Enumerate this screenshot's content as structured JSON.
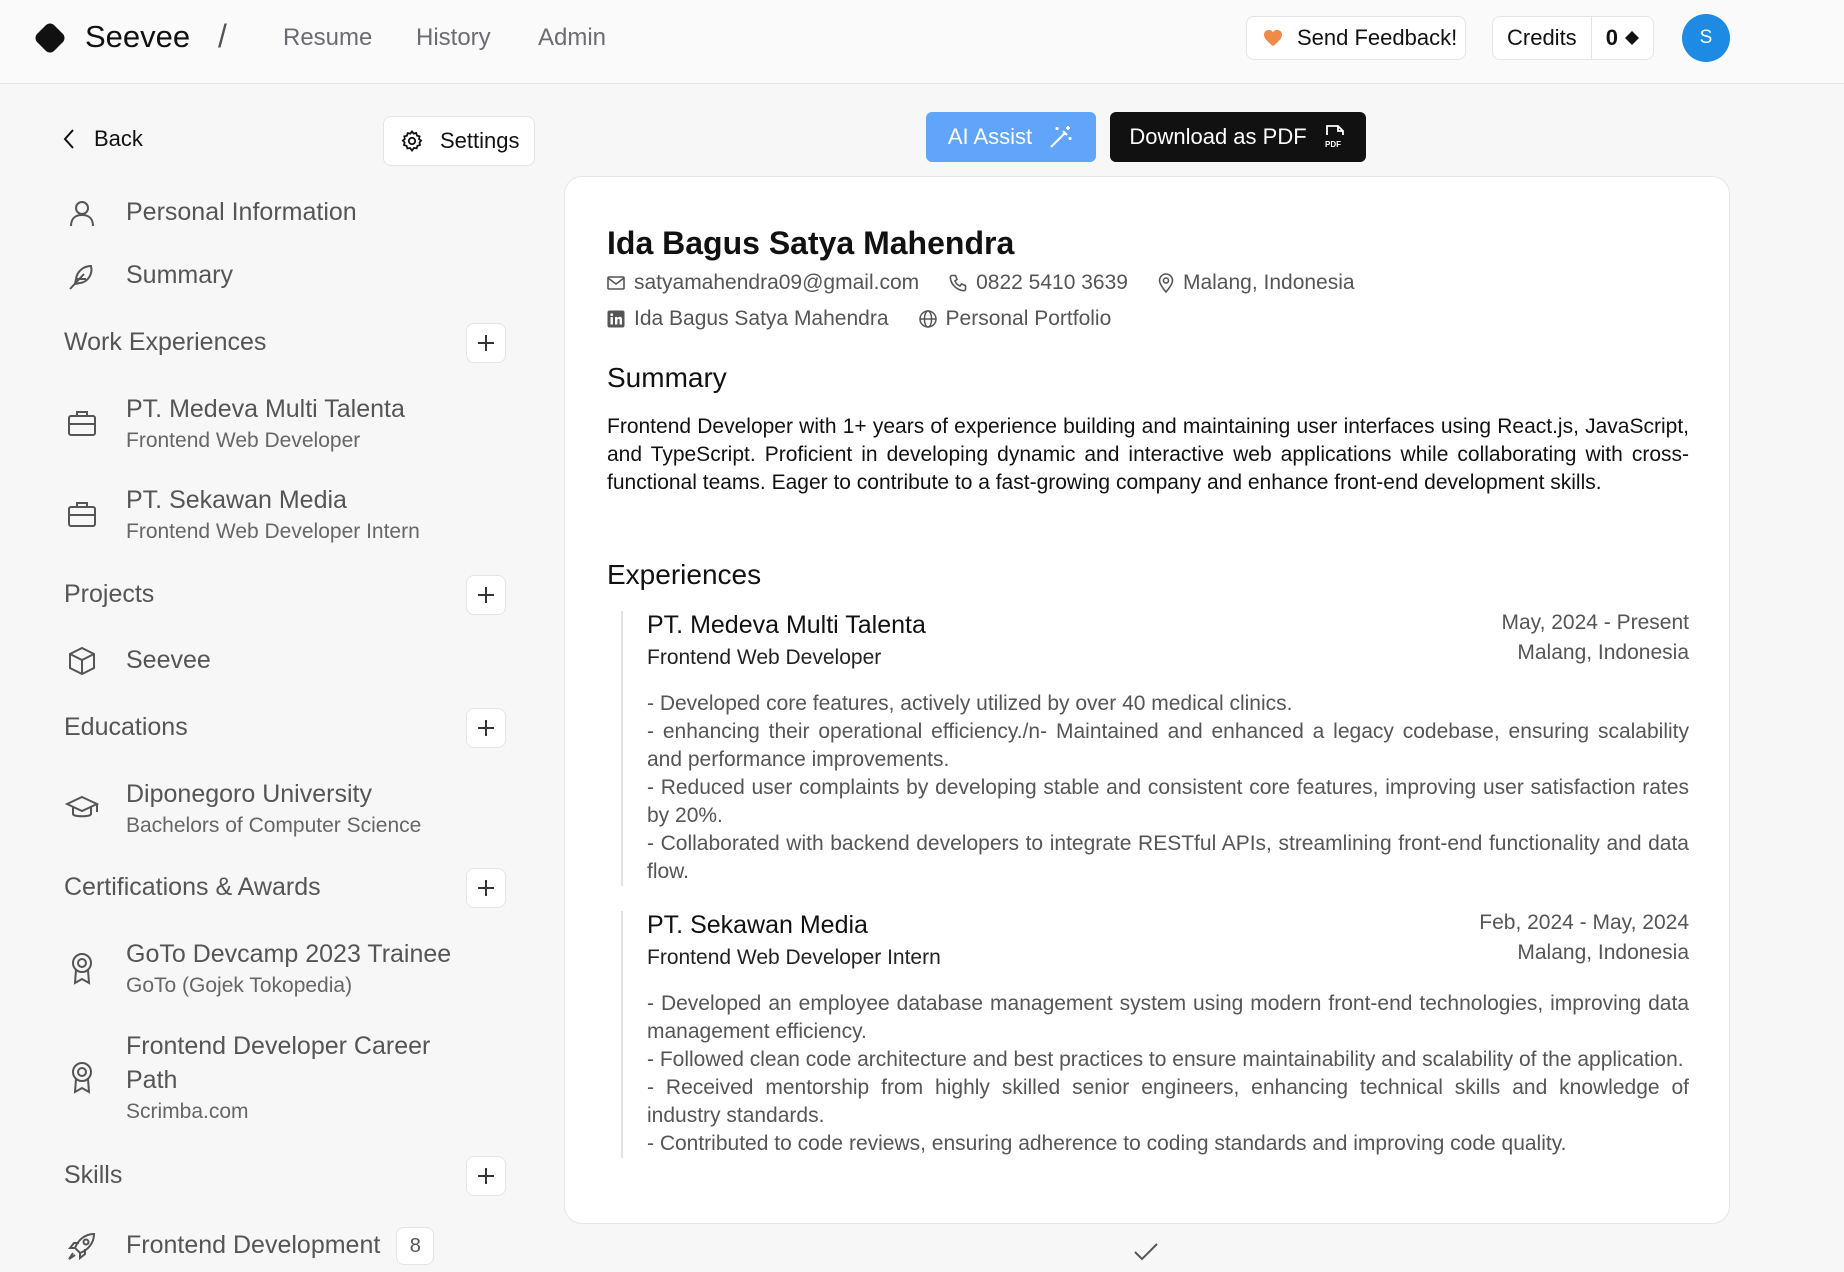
{
  "header": {
    "brand": "Seevee",
    "separator": "/",
    "nav": [
      "Resume",
      "History",
      "Admin"
    ],
    "feedback_label": "Send Feedback!",
    "credits_label": "Credits",
    "credits_value": "0",
    "avatar_initial": "S"
  },
  "sidebar": {
    "back_label": "Back",
    "settings_label": "Settings",
    "personal_information": "Personal Information",
    "summary": "Summary",
    "sections": {
      "work": "Work Experiences",
      "projects": "Projects",
      "educations": "Educations",
      "certifications": "Certifications & Awards",
      "skills": "Skills"
    },
    "work_items": [
      {
        "title": "PT. Medeva Multi Talenta",
        "subtitle": "Frontend Web Developer"
      },
      {
        "title": "PT. Sekawan Media",
        "subtitle": "Frontend Web Developer Intern"
      }
    ],
    "project_items": [
      {
        "title": "Seevee"
      }
    ],
    "education_items": [
      {
        "title": "Diponegoro University",
        "subtitle": "Bachelors of Computer Science"
      }
    ],
    "certification_items": [
      {
        "title": "GoTo Devcamp 2023 Trainee",
        "subtitle": "GoTo (Gojek Tokopedia)"
      },
      {
        "title": "Frontend Developer Career Path",
        "subtitle": "Scrimba.com"
      }
    ],
    "skill_items": [
      {
        "title": "Frontend Development",
        "count": "8"
      }
    ]
  },
  "actions": {
    "ai_assist": "AI Assist",
    "download_pdf": "Download as PDF"
  },
  "resume": {
    "name": "Ida Bagus Satya Mahendra",
    "email": "satyamahendra09@gmail.com",
    "phone": "0822 5410 3639",
    "location": "Malang, Indonesia",
    "linkedin": "Ida Bagus Satya Mahendra",
    "portfolio": "Personal Portfolio",
    "summary_heading": "Summary",
    "summary_text": "Frontend Developer with 1+ years of experience building and maintaining user interfaces using React.js, JavaScript, and TypeScript. Proficient in developing dynamic and interactive web applications while collaborating with cross-functional teams. Eager to contribute to a fast-growing company and enhance front-end development skills.",
    "experiences_heading": "Experiences",
    "experiences": [
      {
        "company": "PT. Medeva Multi Talenta",
        "role": "Frontend Web Developer",
        "dates": "May, 2024 - Present",
        "location": "Malang, Indonesia",
        "bullets": [
          "- Developed core features, actively utilized by over 40 medical clinics.",
          "- enhancing their operational efficiency./n- Maintained and enhanced a legacy codebase, ensuring scalability and performance improvements.",
          "- Reduced user complaints by developing stable and consistent core features, improving user satisfaction rates by 20%.",
          "- Collaborated with backend developers to integrate RESTful APIs, streamlining front-end functionality and data flow."
        ]
      },
      {
        "company": "PT. Sekawan Media",
        "role": "Frontend Web Developer Intern",
        "dates": "Feb, 2024 - May, 2024",
        "location": "Malang, Indonesia",
        "bullets": [
          "- Developed an employee database management system using modern front-end technologies, improving data management efficiency.",
          "- Followed clean code architecture and best practices to ensure maintainability and scalability of the application.",
          "- Received mentorship from highly skilled senior engineers, enhancing technical skills and knowledge of industry standards.",
          "- Contributed to code reviews, ensuring adherence to coding standards and improving code quality."
        ]
      }
    ]
  },
  "colors": {
    "accent_blue": "#60a5fa",
    "avatar_blue": "#1d8ae3",
    "heart_orange": "#f08a4b"
  }
}
